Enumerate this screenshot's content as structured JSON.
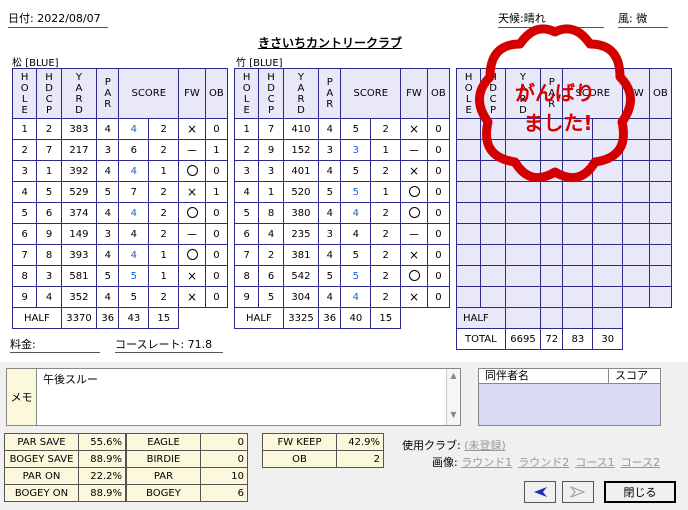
{
  "header": {
    "date": "日付: 2022/08/07",
    "weather_label": "天候:",
    "weather": "晴れ",
    "wind_label": "風:",
    "wind": "微",
    "course": "きさいちカントリークラブ"
  },
  "colors": {
    "grid": "#2a2a8a",
    "birdie": "#1a5fd0",
    "stamp": "#d40000",
    "shade": "#e8e8f8"
  },
  "columns": [
    "HOLE",
    "HDCP",
    "YARD",
    "PAR",
    "SCORE",
    "FW",
    "OB"
  ],
  "out": {
    "label": "松 [BLUE]",
    "rows": [
      [
        "1",
        "2",
        "383",
        "4",
        "4",
        "2",
        "×",
        "0"
      ],
      [
        "2",
        "7",
        "217",
        "3",
        "6",
        "2",
        "－",
        "1"
      ],
      [
        "3",
        "1",
        "392",
        "4",
        "4",
        "1",
        "〇",
        "0"
      ],
      [
        "4",
        "5",
        "529",
        "5",
        "7",
        "2",
        "×",
        "1"
      ],
      [
        "5",
        "6",
        "374",
        "4",
        "4",
        "2",
        "〇",
        "0"
      ],
      [
        "6",
        "9",
        "149",
        "3",
        "4",
        "2",
        "－",
        "0"
      ],
      [
        "7",
        "8",
        "393",
        "4",
        "4",
        "1",
        "〇",
        "0"
      ],
      [
        "8",
        "3",
        "581",
        "5",
        "5",
        "1",
        "×",
        "0"
      ],
      [
        "9",
        "4",
        "352",
        "4",
        "5",
        "2",
        "×",
        "0"
      ]
    ],
    "half": {
      "label": "HALF",
      "yard": "3370",
      "par": "36",
      "score": "43",
      "putts": "15"
    }
  },
  "in": {
    "label": "竹 [BLUE]",
    "rows": [
      [
        "1",
        "7",
        "410",
        "4",
        "5",
        "2",
        "×",
        "0"
      ],
      [
        "2",
        "9",
        "152",
        "3",
        "3",
        "1",
        "－",
        "0"
      ],
      [
        "3",
        "3",
        "401",
        "4",
        "5",
        "2",
        "×",
        "0"
      ],
      [
        "4",
        "1",
        "520",
        "5",
        "5",
        "1",
        "〇",
        "0"
      ],
      [
        "5",
        "8",
        "380",
        "4",
        "4",
        "2",
        "〇",
        "0"
      ],
      [
        "6",
        "4",
        "235",
        "3",
        "4",
        "2",
        "－",
        "0"
      ],
      [
        "7",
        "2",
        "381",
        "4",
        "5",
        "2",
        "×",
        "0"
      ],
      [
        "8",
        "6",
        "542",
        "5",
        "5",
        "2",
        "〇",
        "0"
      ],
      [
        "9",
        "5",
        "304",
        "4",
        "4",
        "2",
        "×",
        "0"
      ]
    ],
    "half": {
      "label": "HALF",
      "yard": "3325",
      "par": "36",
      "score": "40",
      "putts": "15"
    }
  },
  "extra": {
    "half_label": "HALF",
    "total_label": "TOTAL",
    "total_yard": "6695",
    "total_par": "72",
    "total_score": "83",
    "total_putts": "30"
  },
  "stamp": {
    "line1": "がんばり",
    "line2": "ました!"
  },
  "fee_label": "料金:",
  "rating_label": "コースレート:",
  "rating": "71.8",
  "memo": {
    "label": "メモ",
    "text": "午後スルー"
  },
  "companions": {
    "name_header": "同伴者名",
    "score_header": "スコア"
  },
  "stats1": [
    [
      "PAR SAVE",
      "55.6%"
    ],
    [
      "BOGEY SAVE",
      "88.9%"
    ],
    [
      "PAR ON",
      "22.2%"
    ],
    [
      "BOGEY ON",
      "88.9%"
    ]
  ],
  "stats2": [
    [
      "EAGLE",
      "0"
    ],
    [
      "BIRDIE",
      "0"
    ],
    [
      "PAR",
      "10"
    ],
    [
      "BOGEY",
      "6"
    ]
  ],
  "stats3": [
    [
      "FW KEEP",
      "42.9%"
    ],
    [
      "OB",
      "2"
    ]
  ],
  "club_label": "使用クラブ:",
  "club_value": "(未登録)",
  "image_label": "画像:",
  "image_links": [
    "ラウンド1",
    "ラウンド2",
    "コース1",
    "コース2"
  ],
  "close_label": "閉じる"
}
